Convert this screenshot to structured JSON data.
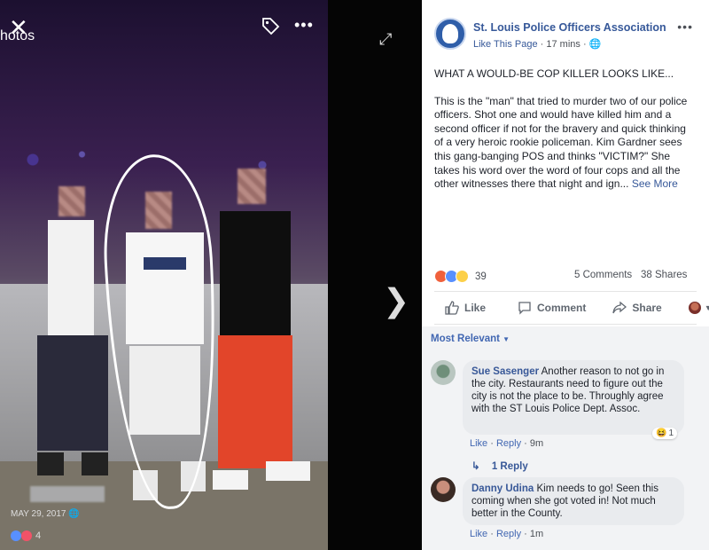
{
  "viewer": {
    "photos_label": "hotos",
    "photo_date": "MAY 29, 2017",
    "reaction_count": "4"
  },
  "post": {
    "page_name": "St. Louis Police Officers Association",
    "like_this_page": "Like This Page",
    "time": "17 mins",
    "headline": "WHAT A WOULD-BE COP KILLER LOOKS LIKE...",
    "body": "This is the \"man\" that tried to murder two of our police officers. Shot one and would have killed him and a second officer if not for the bravery and quick thinking of a very heroic rookie policeman. Kim Gardner sees this gang-banging POS and thinks \"VICTIM?\" She takes his word over the word of four cops and all the other witnesses there that night and ign...",
    "see_more": "See More",
    "reaction_count": "39",
    "comments_count": "5 Comments",
    "shares_count": "38 Shares",
    "actions": {
      "like": "Like",
      "comment": "Comment",
      "share": "Share"
    }
  },
  "comments": {
    "sort_label": "Most Relevant",
    "items": [
      {
        "author": "Sue Sasenger",
        "text": "Another reason to not go in the city. Restaurants need to figure out the city is not the place to be. Throughly agree with the ST Louis Police Dept. Assoc.",
        "like": "Like",
        "reply": "Reply",
        "time": "9m",
        "reaction_count": "1"
      },
      {
        "author": "Danny Udina",
        "text": "Kim needs to go! Seen this coming when she got voted in! Not much better in the County.",
        "like": "Like",
        "reply": "Reply",
        "time": "1m"
      }
    ],
    "replies_label": "1 Reply"
  },
  "colors": {
    "link": "#365899",
    "accent": "#4267b2",
    "bubble": "#e9ebee",
    "panel_bg": "#f2f3f5"
  }
}
